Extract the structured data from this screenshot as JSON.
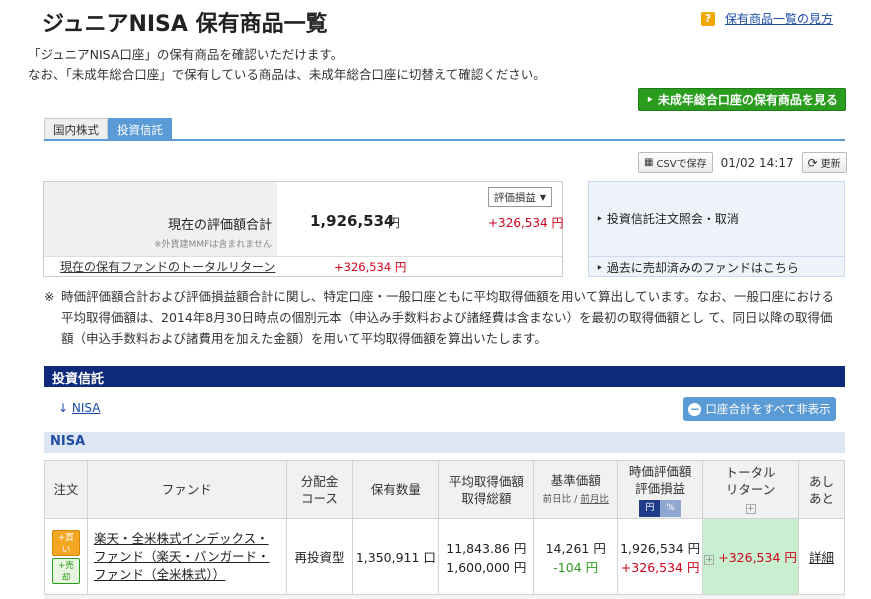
{
  "header": {
    "title": "ジュニアNISA 保有商品一覧",
    "help_icon": "?",
    "help_link": "保有商品一覧の見方"
  },
  "description": {
    "line1": "「ジュニアNISA口座」の保有商品を確認いただけます。",
    "line2": "なお、「未成年総合口座」で保有している商品は、未成年総合口座に切替えて確認ください。"
  },
  "minor_account_button": "‣ 未成年総合口座の保有商品を見る",
  "tabs": [
    {
      "label": "国内株式",
      "active": false
    },
    {
      "label": "投資信託",
      "active": true
    }
  ],
  "toolbar": {
    "csv_label": "CSVで保存",
    "timestamp": "01/02 14:17",
    "refresh_label": "更新"
  },
  "summary": {
    "label": "現在の評価額合計",
    "note": "※外貨建MMFは含まれません",
    "value": "1,926,534",
    "unit": "円",
    "select_value": "評価損益",
    "profit": "+326,534 円",
    "total_return_label": "現在の保有ファンドのトータルリターン",
    "total_return_value": "+326,534 円"
  },
  "side_links": {
    "link1": "‣ 投資信託注文照会・取消",
    "link2": "‣ 過去に売却済みのファンドはこちら"
  },
  "note": {
    "mark": "※",
    "text": "時価評価額合計および評価損益額合計に関し、特定口座・一般口座ともに平均取得価額を用いて算出しています。なお、一般口座における平均取得価額は、2014年8月30日時点の個別元本（申込み手数料および諸経費は含まない）を最初の取得価額とし て、同日以降の取得価額（申込手数料および諸費用を加えた金額）を用いて平均取得価額を算出いたします。"
  },
  "section": {
    "title": "投資信託",
    "anchor_arrow": "↓",
    "anchor_label": "NISA",
    "hide_button": "口座合計をすべて非表示",
    "nisa_label": "NISA"
  },
  "table": {
    "headers": {
      "order": "注文",
      "fund": "ファンド",
      "course_1": "分配金",
      "course_2": "コース",
      "qty": "保有数量",
      "avg_1": "平均取得価額",
      "avg_2": "取得総額",
      "base_1": "基準価額",
      "base_2a": "前日比 / ",
      "base_2b": "前月比",
      "market_1": "時価評価額",
      "market_2": "評価損益",
      "toggle_yen": "円",
      "toggle_pct": "%",
      "total_1": "トータル",
      "total_2": "リターン",
      "ashi_1": "あし",
      "ashi_2": "あと",
      "plus": "+"
    },
    "rows": [
      {
        "buy": "+買い",
        "sell": "+売却",
        "fund": "楽天・全米株式インデックス・ファンド（楽天・バンガード・ファンド（全米株式））",
        "course": "再投資型",
        "qty": "1,350,911 口",
        "avg_price": "11,843.86 円",
        "avg_total": "1,600,000 円",
        "base_price": "14,261 円",
        "base_diff": "-104 円",
        "market_value": "1,926,534 円",
        "market_profit": "+326,534 円",
        "total_return": "+326,534 円",
        "detail": "詳細"
      }
    ]
  },
  "colors": {
    "accent_blue": "#5b9bd5",
    "section_navy": "#0d2a7a",
    "green_button": "#2b9d1e",
    "profit_red": "#d0021b"
  }
}
